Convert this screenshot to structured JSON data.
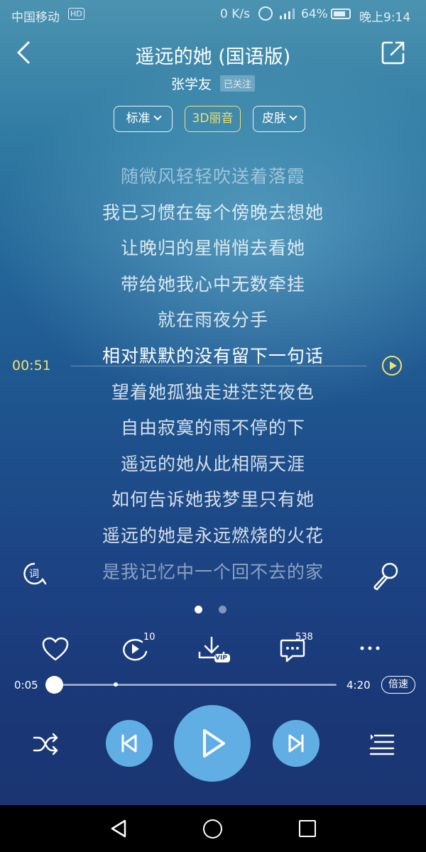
{
  "status_bar": {
    "carrier": "中国移动",
    "hd": "HD",
    "net_speed": "0 K/s",
    "battery": "64%",
    "time": "晚上9:14"
  },
  "header": {
    "title": "遥远的她 (国语版)",
    "artist": "张学友",
    "follow_status": "已关注"
  },
  "modes": {
    "standard": "标准",
    "effect": "3D丽音",
    "skin": "皮肤"
  },
  "lyrics": {
    "lines": [
      "随微风轻轻吹送着落霞",
      "我已习惯在每个傍晚去想她",
      "让晚归的星悄悄去看她",
      "带给她我心中无数牵挂",
      "就在雨夜分手",
      "相对默默的没有留下一句话",
      "望着她孤独走进茫茫夜色",
      "自由寂寞的雨不停的下",
      "遥远的她从此相隔天涯",
      "如何告诉她我梦里只有她",
      "遥远的她是永远燃烧的火花",
      "是我记忆中一个回不去的家"
    ],
    "current_index": 5,
    "seek_time": "00:51"
  },
  "actions": {
    "comment_count": "538",
    "loop_count": "10",
    "download_badge": "VIP"
  },
  "progress": {
    "current": "0:05",
    "total": "4:20",
    "fraction": 0.02,
    "marker_fraction": 0.235,
    "speed_label": "倍速"
  },
  "colors": {
    "accent_yellow": "#f1e16b",
    "button_blue": "#60aee3"
  },
  "icons": {
    "back": "chevron-left-icon",
    "share": "share-icon",
    "lyric": "lyric-icon",
    "mic": "microphone-icon",
    "like": "heart-icon",
    "loop": "loop-icon",
    "download": "download-icon",
    "comments": "comments-icon",
    "more": "more-icon",
    "shuffle": "shuffle-icon",
    "prev": "previous-icon",
    "play": "play-icon",
    "next": "next-icon",
    "playlist": "playlist-icon"
  }
}
